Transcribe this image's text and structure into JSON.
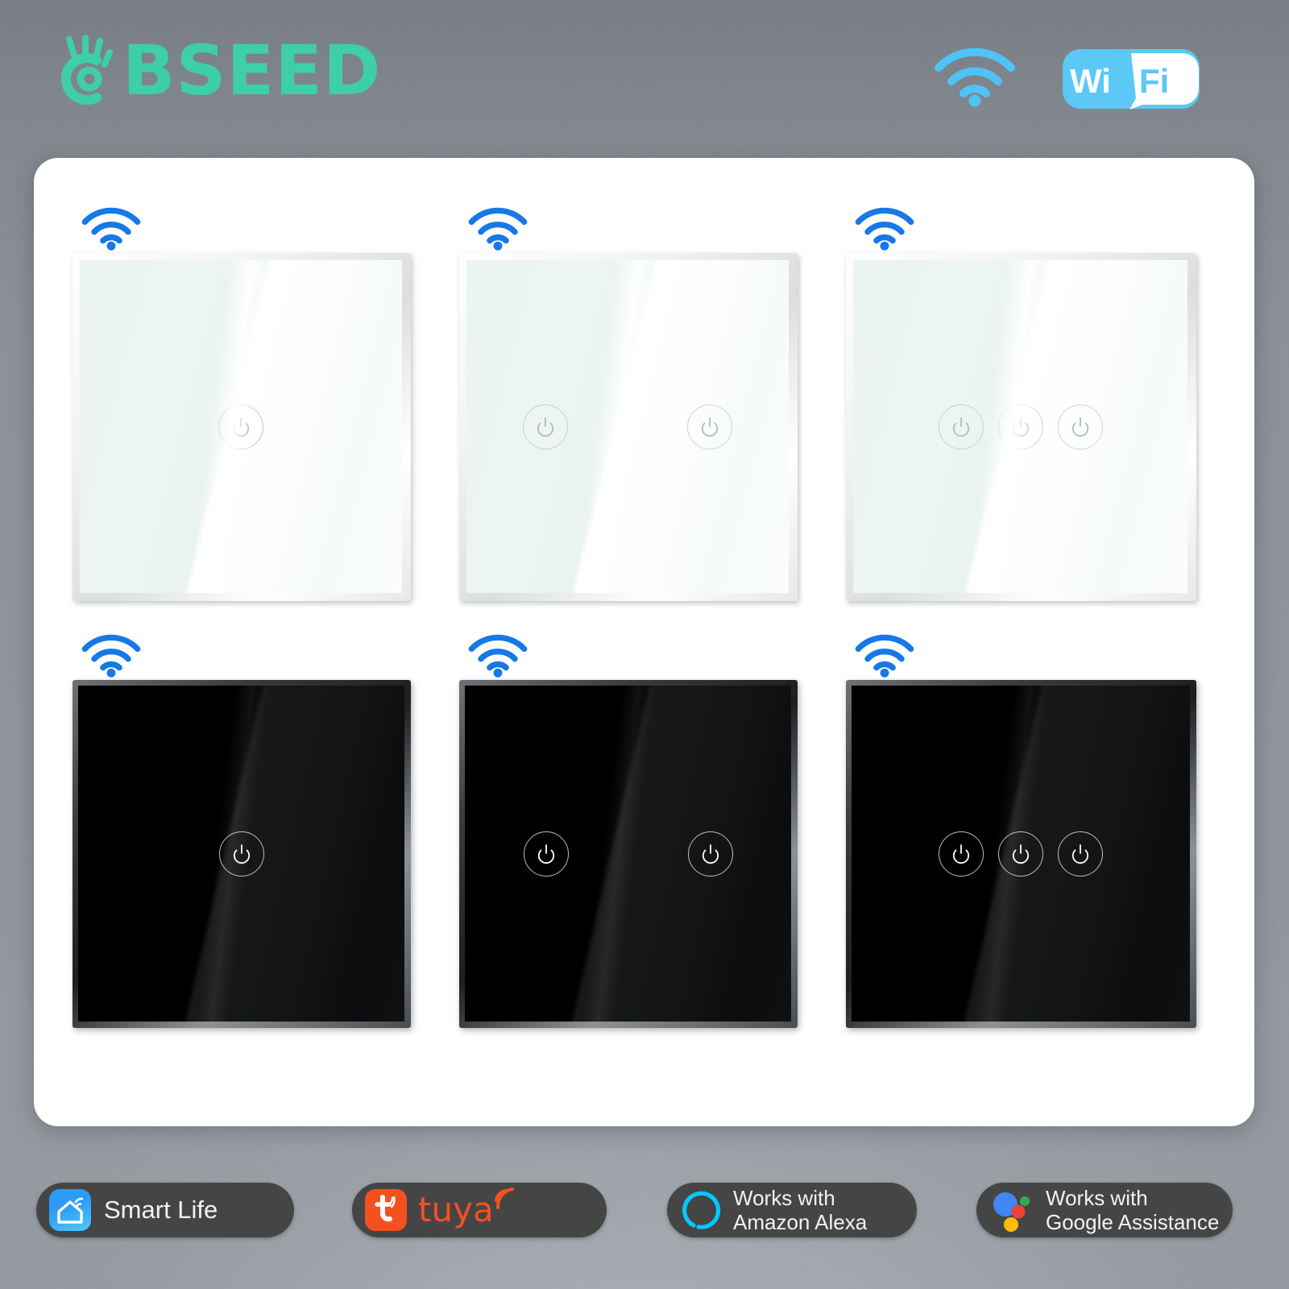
{
  "brand": {
    "name": "BSEED",
    "logo_icon": "ok-hand-icon",
    "color": "#3ECFA7"
  },
  "header": {
    "wifi_icon": "wifi-signal-icon",
    "wifi_badge": {
      "icon": "wifi-logo-badge",
      "text_left": "Wi",
      "text_right": "Fi",
      "color": "#5BC8F5"
    }
  },
  "product": {
    "accent_wifi_color": "#1778E8",
    "switches": [
      {
        "id": "white-1-gang",
        "finish": "white",
        "gangs": 1,
        "wifi_icon": "wifi-signal-icon",
        "button_icon": "power-icon"
      },
      {
        "id": "white-2-gang",
        "finish": "white",
        "gangs": 2,
        "wifi_icon": "wifi-signal-icon",
        "button_icon": "power-icon"
      },
      {
        "id": "white-3-gang",
        "finish": "white",
        "gangs": 3,
        "wifi_icon": "wifi-signal-icon",
        "button_icon": "power-icon"
      },
      {
        "id": "black-1-gang",
        "finish": "black",
        "gangs": 1,
        "wifi_icon": "wifi-signal-icon",
        "button_icon": "power-icon"
      },
      {
        "id": "black-2-gang",
        "finish": "black",
        "gangs": 2,
        "wifi_icon": "wifi-signal-icon",
        "button_icon": "power-icon"
      },
      {
        "id": "black-3-gang",
        "finish": "black",
        "gangs": 3,
        "wifi_icon": "wifi-signal-icon",
        "button_icon": "power-icon"
      }
    ]
  },
  "badges": [
    {
      "id": "smart-life",
      "icon": "smart-life-house-icon",
      "label": "Smart Life",
      "line1": "",
      "line2": "",
      "icon_color": "#2B9BFA"
    },
    {
      "id": "tuya",
      "icon": "tuya-logo-icon",
      "label": "tuya",
      "line1": "",
      "line2": "",
      "icon_color": "#F4511E"
    },
    {
      "id": "amazon-alexa",
      "icon": "alexa-ring-icon",
      "label": "",
      "line1": "Works with",
      "line2": "Amazon Alexa",
      "icon_color": "#00CAFF"
    },
    {
      "id": "google-assistant",
      "icon": "google-assistant-dots-icon",
      "label": "",
      "line1": "Works with",
      "line2": "Google Assistance",
      "icon_color": "#4285F4"
    }
  ]
}
